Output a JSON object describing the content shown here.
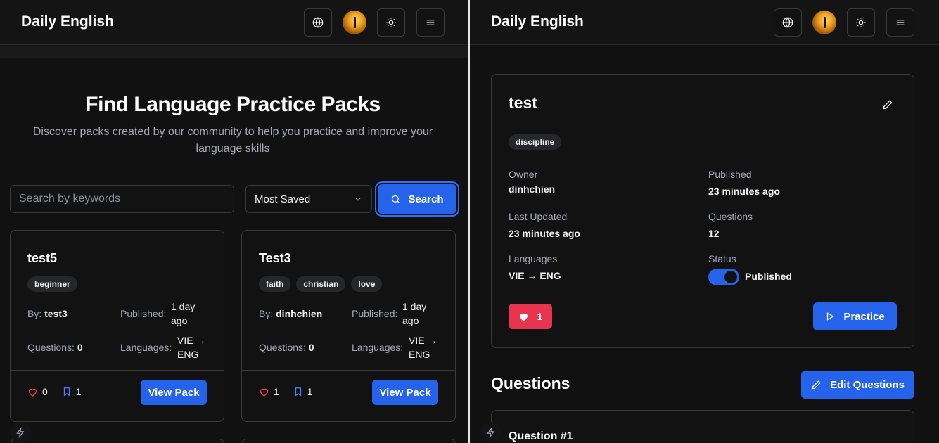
{
  "left": {
    "header": {
      "brand": "Daily English"
    },
    "hero": {
      "title": "Find Language Practice Packs",
      "subtitle": "Discover packs created by our community to help you practice and improve your language skills"
    },
    "search": {
      "placeholder": "Search by keywords",
      "sort_selected": "Most Saved",
      "button_label": "Search"
    },
    "cards": [
      {
        "title": "test5",
        "tags": [
          "beginner"
        ],
        "by_label": "By:",
        "by_value": "test3",
        "published_label": "Published:",
        "published_value": "1 day ago",
        "questions_label": "Questions:",
        "questions_value": "0",
        "languages_label": "Languages:",
        "languages_value": "VIE → ENG",
        "likes": "0",
        "saves": "1",
        "view_label": "View Pack"
      },
      {
        "title": "Test3",
        "tags": [
          "faith",
          "christian",
          "love"
        ],
        "by_label": "By:",
        "by_value": "dinhchien",
        "published_label": "Published:",
        "published_value": "1 day ago",
        "questions_label": "Questions:",
        "questions_value": "0",
        "languages_label": "Languages:",
        "languages_value": "VIE → ENG",
        "likes": "1",
        "saves": "1",
        "view_label": "View Pack"
      }
    ]
  },
  "right": {
    "header": {
      "brand": "Daily English"
    },
    "pack": {
      "title": "test",
      "tag": "discipline",
      "owner_label": "Owner",
      "owner_value": "dinhchien",
      "published_label": "Published",
      "published_value": "23 minutes ago",
      "updated_label": "Last Updated",
      "updated_value": "23 minutes ago",
      "questions_label": "Questions",
      "questions_value": "12",
      "languages_label": "Languages",
      "languages_value": "VIE → ENG",
      "status_label": "Status",
      "status_value": "Published",
      "likes": "1",
      "practice_label": "Practice"
    },
    "questions": {
      "heading": "Questions",
      "edit_label": "Edit Questions",
      "first_title": "Question #1"
    }
  },
  "colors": {
    "accent": "#2563eb",
    "like": "#e8344e",
    "background": "#111111",
    "border": "#3a3a3a"
  },
  "icons": [
    "globe-icon",
    "avatar",
    "sun-icon",
    "menu-icon",
    "chevron-down-icon",
    "search-icon",
    "heart-icon",
    "bookmark-icon",
    "pencil-icon",
    "play-icon",
    "bolt-icon"
  ]
}
